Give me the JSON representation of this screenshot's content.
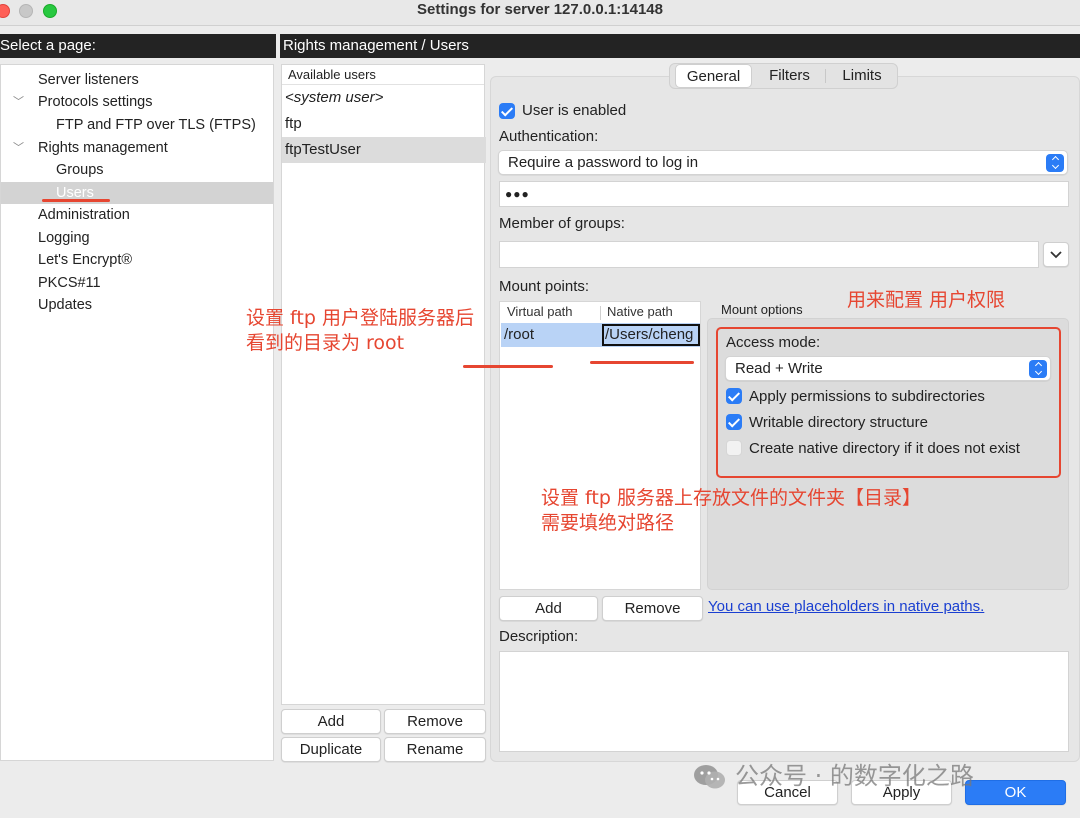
{
  "window": {
    "title": "Settings for server 127.0.0.1:14148"
  },
  "left_pane": {
    "header": "Select a page:",
    "items": [
      {
        "label": "Server listeners"
      },
      {
        "label": "Protocols settings"
      },
      {
        "label": "FTP and FTP over TLS (FTPS)"
      },
      {
        "label": "Rights management"
      },
      {
        "label": "Groups"
      },
      {
        "label": "Users"
      },
      {
        "label": "Administration"
      },
      {
        "label": "Logging"
      },
      {
        "label": "Let's Encrypt®"
      },
      {
        "label": "PKCS#11"
      },
      {
        "label": "Updates"
      }
    ]
  },
  "right_header": "Rights management / Users",
  "users": {
    "header": "Available users",
    "items": [
      {
        "label": "<system user>"
      },
      {
        "label": "ftp"
      },
      {
        "label": "ftpTestUser"
      }
    ],
    "add": "Add",
    "remove": "Remove",
    "duplicate": "Duplicate",
    "rename": "Rename"
  },
  "tabs": {
    "general": "General",
    "filters": "Filters",
    "limits": "Limits"
  },
  "general": {
    "user_enabled": "User is enabled",
    "authentication_label": "Authentication:",
    "authentication_value": "Require a password to log in",
    "password_value": "●●●",
    "member_of_groups": "Member of groups:",
    "mount_points": "Mount points:",
    "virtual_path_header": "Virtual path",
    "native_path_header": "Native path",
    "virtual_path_value": "/root",
    "native_path_value": "/Users/cheng",
    "mount_options": "Mount options",
    "access_mode_label": "Access mode:",
    "access_mode_value": "Read + Write",
    "apply_permissions": "Apply permissions to subdirectories",
    "writable_structure": "Writable directory structure",
    "create_native": "Create native directory if it does not exist",
    "mount_add": "Add",
    "mount_remove": "Remove",
    "placeholders_link": "You can use placeholders in native paths.",
    "description_label": "Description:"
  },
  "dialog": {
    "cancel": "Cancel",
    "apply": "Apply",
    "ok": "OK"
  },
  "annotations": {
    "note_virtual_line1": "设置 ftp 用户登陆服务器后",
    "note_virtual_line2": "看到的目录为 root",
    "note_permissions": "用来配置 用户权限",
    "note_native_line1": "设置 ftp 服务器上存放文件的文件夹【目录】",
    "note_native_line2": "需要填绝对路径"
  },
  "watermark": {
    "text": "公众号 · 的数字化之路"
  },
  "colors": {
    "accent": "#2b7cf6",
    "annotation": "#e64631",
    "header_bg": "#232323"
  }
}
